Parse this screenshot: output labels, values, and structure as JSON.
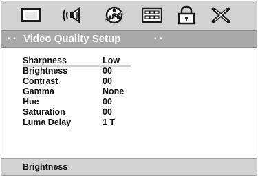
{
  "toolbar": {
    "icons": [
      "tv-icon",
      "speaker-icon",
      "film-reel-icon",
      "video-panel-icon",
      "lock-icon",
      "close-x-icon"
    ]
  },
  "header": {
    "title": "Video Quality Setup",
    "dots_left": "• •",
    "dots_right": "• •"
  },
  "settings": [
    {
      "label": "Sharpness",
      "value": "Low"
    },
    {
      "label": "Brightness",
      "value": "00"
    },
    {
      "label": "Contrast",
      "value": "00"
    },
    {
      "label": "Gamma",
      "value": "None"
    },
    {
      "label": "Hue",
      "value": "00"
    },
    {
      "label": "Saturation",
      "value": "00"
    },
    {
      "label": "Luma Delay",
      "value": "1 T"
    }
  ],
  "footer": {
    "help_text": "Brightness"
  },
  "colors": {
    "panel": "#d2d2d2",
    "titlebar": "#a9a9a9",
    "text": "#111111"
  }
}
